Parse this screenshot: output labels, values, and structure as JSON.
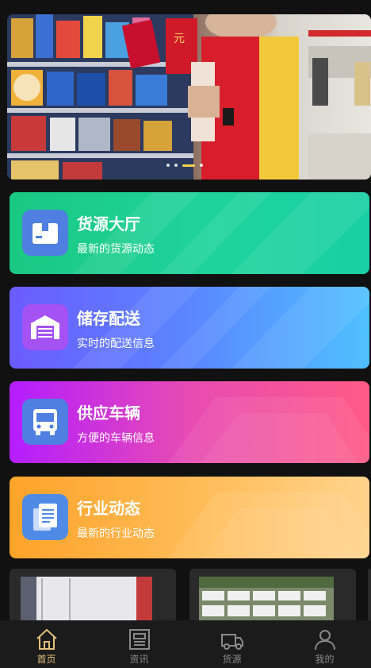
{
  "banner": {
    "slide_count": 4,
    "active_slide": 2
  },
  "cards": [
    {
      "title": "货源大厅",
      "subtitle": "最新的货源动态",
      "icon": "package-box-icon"
    },
    {
      "title": "储存配送",
      "subtitle": "实时的配送信息",
      "icon": "warehouse-icon"
    },
    {
      "title": "供应车辆",
      "subtitle": "方便的车辆信息",
      "icon": "bus-icon"
    },
    {
      "title": "行业动态",
      "subtitle": "最新的行业动态",
      "icon": "document-icon"
    }
  ],
  "tabbar": {
    "items": [
      {
        "label": "首页",
        "icon": "home-icon",
        "active": true
      },
      {
        "label": "资讯",
        "icon": "news-icon",
        "active": false
      },
      {
        "label": "货源",
        "icon": "truck-icon",
        "active": false
      },
      {
        "label": "我的",
        "icon": "user-icon",
        "active": false
      }
    ]
  },
  "colors": {
    "background": "#111111",
    "tab_active": "#e2c07a",
    "tab_inactive": "#8a8a8a"
  }
}
